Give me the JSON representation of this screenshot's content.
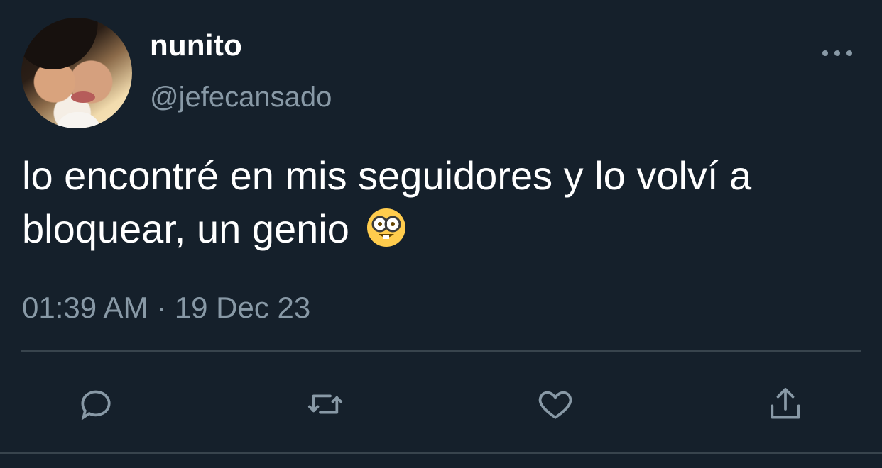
{
  "user": {
    "display_name": "nunito",
    "handle": "@jefecansado"
  },
  "tweet": {
    "text": "lo encontré en mis seguidores y lo volví a bloquear, un genio",
    "emoji": "nerd-face",
    "timestamp": "01:39 AM · 19 Dec 23"
  },
  "actions": [
    "reply-icon",
    "retweet-icon",
    "like-icon",
    "share-icon"
  ],
  "colors": {
    "background": "#15202b",
    "text": "#ffffff",
    "secondary_text": "#8899a6",
    "divider": "#38444d"
  }
}
